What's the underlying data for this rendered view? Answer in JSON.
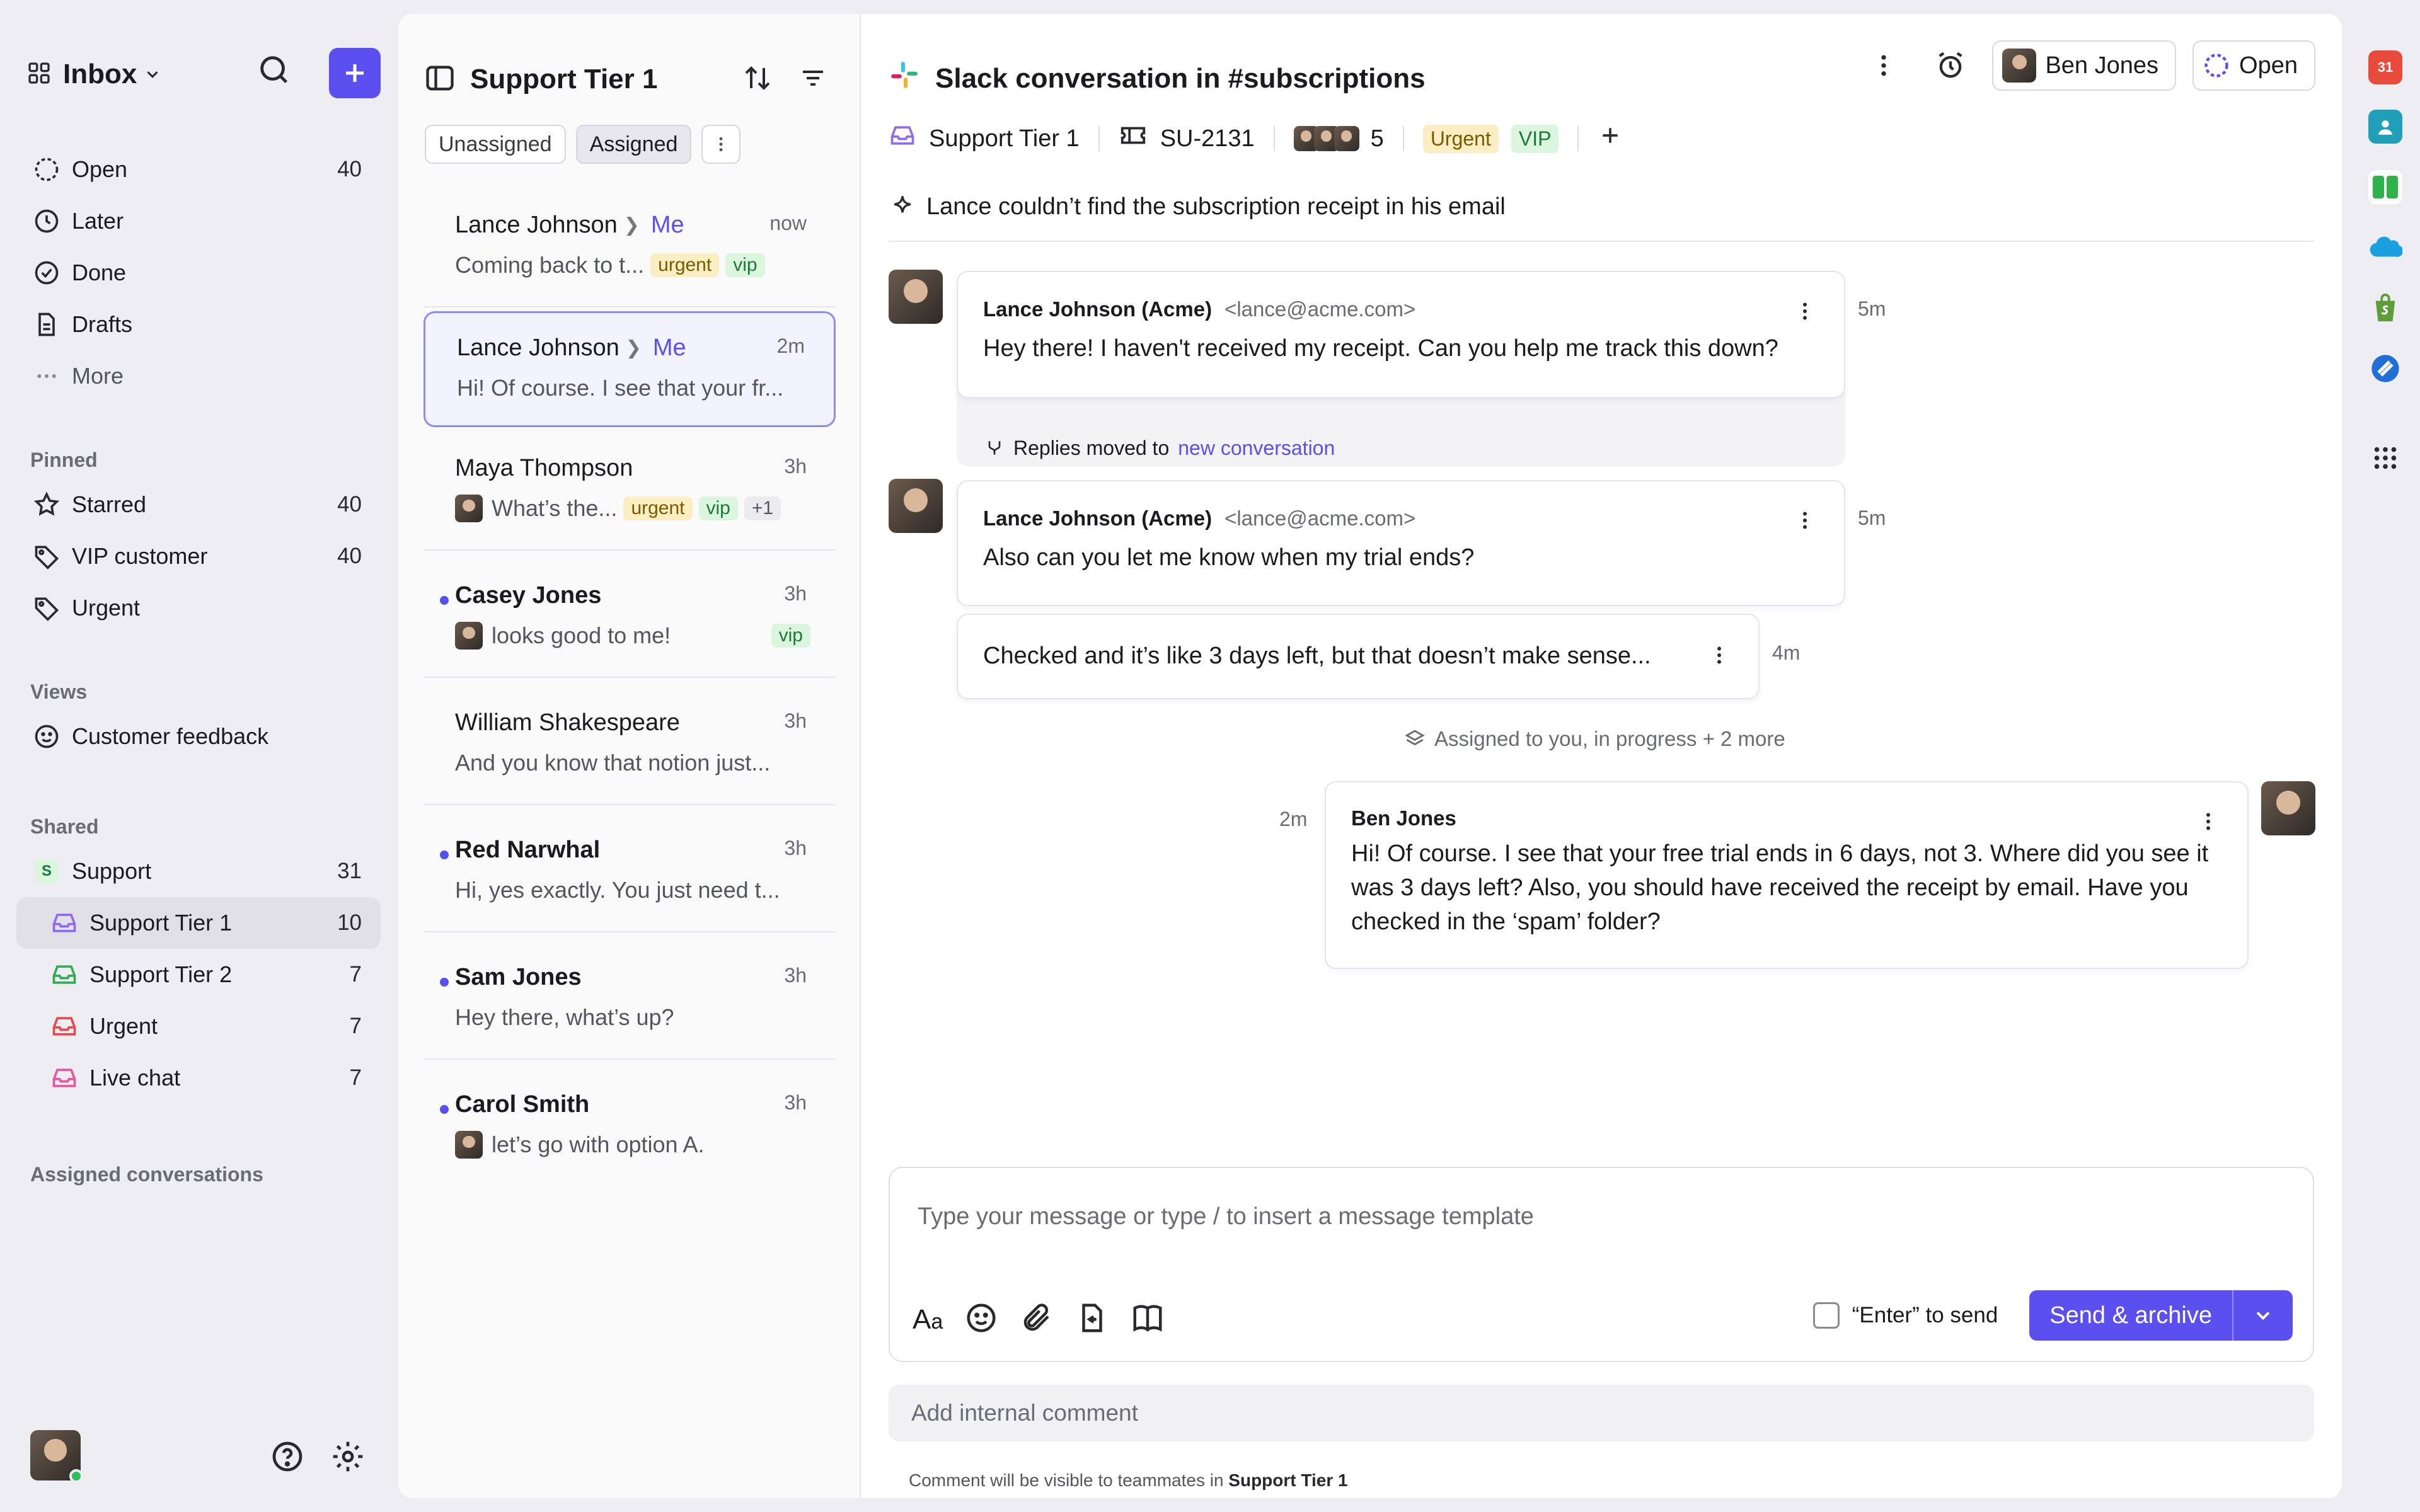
{
  "sidebar": {
    "title": "Inbox",
    "nav": [
      {
        "label": "Open",
        "count": "40"
      },
      {
        "label": "Later",
        "count": ""
      },
      {
        "label": "Done",
        "count": ""
      },
      {
        "label": "Drafts",
        "count": ""
      },
      {
        "label": "More",
        "count": ""
      }
    ],
    "pinned_title": "Pinned",
    "pinned": [
      {
        "label": "Starred",
        "count": "40"
      },
      {
        "label": "VIP customer",
        "count": "40"
      },
      {
        "label": "Urgent",
        "count": ""
      }
    ],
    "views_title": "Views",
    "views": [
      {
        "label": "Customer feedback"
      }
    ],
    "shared_title": "Shared",
    "shared": [
      {
        "label": "Support",
        "count": "31",
        "badge": "S"
      },
      {
        "label": "Support Tier 1",
        "count": "10",
        "color": "#8e6cf0"
      },
      {
        "label": "Support Tier 2",
        "count": "7",
        "color": "#2faa55"
      },
      {
        "label": "Urgent",
        "count": "7",
        "color": "#e5484d"
      },
      {
        "label": "Live chat",
        "count": "7",
        "color": "#e8559b"
      }
    ],
    "assigned_title": "Assigned conversations"
  },
  "list": {
    "title": "Support Tier 1",
    "tabs": [
      "Unassigned",
      "Assigned"
    ],
    "conversations": [
      {
        "name": "Lance Johnson",
        "assignee": "Me",
        "time": "now",
        "preview": "Coming back to t...",
        "badges": [
          "urgent",
          "vip"
        ],
        "unread": false
      },
      {
        "name": "Lance Johnson",
        "assignee": "Me",
        "time": "2m",
        "preview": "Hi! Of course. I see that your fr...",
        "badges": [],
        "unread": false
      },
      {
        "name": "Maya Thompson",
        "assignee": "",
        "time": "3h",
        "preview": "What’s the...",
        "badges": [
          "urgent",
          "vip",
          "+1"
        ],
        "unread": false
      },
      {
        "name": "Casey Jones",
        "assignee": "",
        "time": "3h",
        "preview": "looks good to me!",
        "badges": [
          "vip"
        ],
        "unread": true
      },
      {
        "name": "William Shakespeare",
        "assignee": "",
        "time": "3h",
        "preview": "And you know that notion just...",
        "badges": [],
        "unread": false
      },
      {
        "name": "Red Narwhal",
        "assignee": "",
        "time": "3h",
        "preview": "Hi, yes exactly. You just need t...",
        "badges": [],
        "unread": true
      },
      {
        "name": "Sam Jones",
        "assignee": "",
        "time": "3h",
        "preview": "Hey there, what’s up?",
        "badges": [],
        "unread": true
      },
      {
        "name": "Carol Smith",
        "assignee": "",
        "time": "3h",
        "preview": "let’s go with option A.",
        "badges": [],
        "unread": true
      }
    ]
  },
  "main": {
    "title": "Slack conversation in #subscriptions",
    "assignee": "Ben Jones",
    "status": "Open",
    "inbox": "Support Tier 1",
    "ticket_id": "SU-2131",
    "participants_count": "5",
    "tags": [
      "Urgent",
      "VIP"
    ],
    "summary": "Lance couldn’t find the subscription receipt in his email",
    "messages": [
      {
        "from": "Lance Johnson (Acme)",
        "email": "<lance@acme.com>",
        "body": "Hey there! I haven't received my receipt. Can you help me track this down?",
        "time": "5m"
      },
      {
        "from": "Lance Johnson (Acme)",
        "email": "<lance@acme.com>",
        "body": "Also can you let me know when my trial ends?",
        "time": "5m"
      },
      {
        "from": "",
        "email": "",
        "body": "Checked and it’s like 3 days left, but that doesn’t make sense...",
        "time": "4m"
      },
      {
        "from": "Ben Jones",
        "email": "",
        "body": "Hi! Of course. I see that your free trial ends in 6 days, not 3. Where did you see it was 3 days left? Also, you should have received the receipt by email. Have you checked in the ‘spam’ folder?",
        "time": "2m"
      }
    ],
    "moved_text": "Replies moved to",
    "moved_link": "new conversation",
    "event_text": "Assigned to you, in progress + 2 more",
    "composer": {
      "placeholder": "Type your message or type / to insert a message template",
      "enter_label": "“Enter” to send",
      "send_label": "Send & archive"
    },
    "internal_placeholder": "Add internal comment",
    "internal_note_prefix": "Comment will be visible to teammates in",
    "internal_note_team": "Support Tier 1"
  },
  "rail": {
    "calendar_day": "31"
  },
  "colors": {
    "accent": "#5b4ff0",
    "urgent_bg": "#fbeec2",
    "vip_bg": "#dcf5df"
  }
}
